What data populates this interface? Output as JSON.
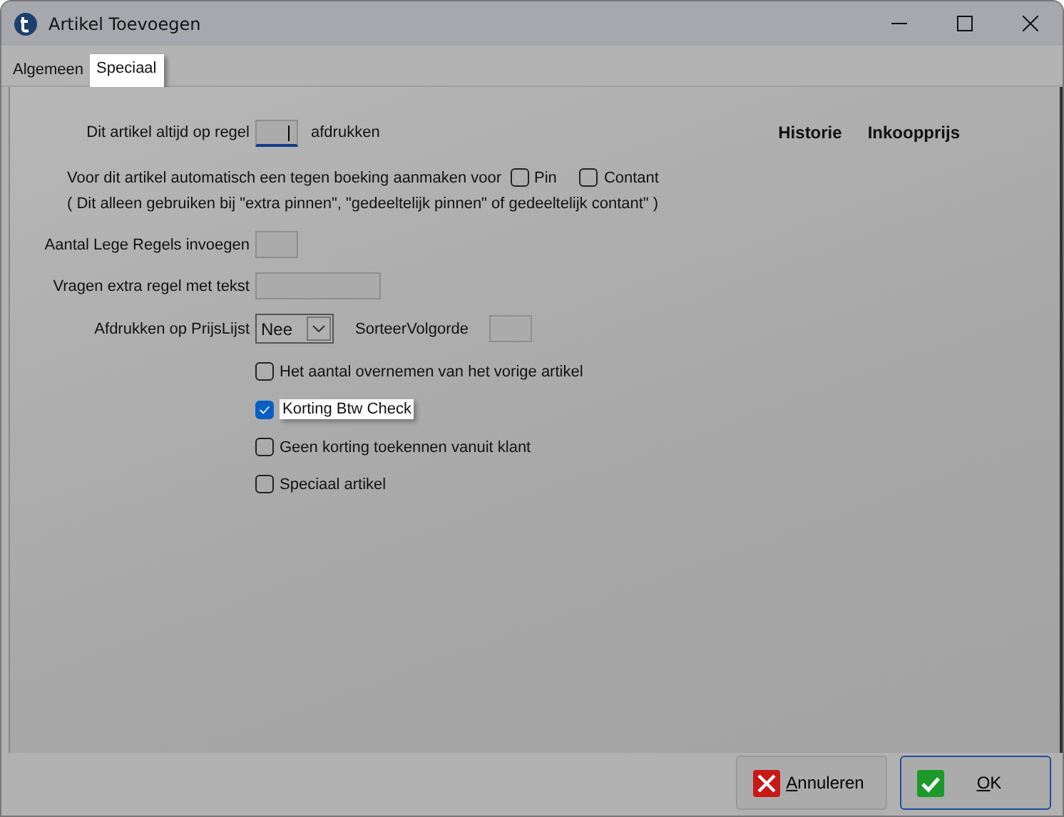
{
  "window": {
    "title": "Artikel Toevoegen"
  },
  "tabs": [
    {
      "label": "Algemeen",
      "selected": false
    },
    {
      "label": "Speciaal",
      "selected": true
    }
  ],
  "print_line": {
    "label": "Dit artikel altijd op regel",
    "suffix": "afdrukken"
  },
  "links": [
    "Historie",
    "Inkoopprijs"
  ],
  "auto_booking": {
    "label": "Voor dit artikel automatisch een tegen boeking aanmaken voor",
    "options": [
      {
        "label": "Pin",
        "checked": false
      },
      {
        "label": "Contant",
        "checked": false
      }
    ],
    "note": "( Dit alleen gebruiken bij \"extra pinnen\", \"gedeeltelijk pinnen\" of gedeeltelijk contant\" )"
  },
  "empty_lines": {
    "label": "Aantal Lege Regels invoegen"
  },
  "extra_line": {
    "label": "Vragen extra regel met tekst"
  },
  "price_list": {
    "label": "Afdrukken op PrijsLijst",
    "value": "Nee",
    "sort_label": "SorteerVolgorde"
  },
  "checkboxes": [
    {
      "label": "Het aantal overnemen van het vorige artikel",
      "checked": false,
      "selected": false
    },
    {
      "label": "Korting Btw Check",
      "checked": true,
      "selected": true
    },
    {
      "label": "Geen korting toekennen vanuit klant",
      "checked": false,
      "selected": false
    },
    {
      "label": "Speciaal artikel",
      "checked": false,
      "selected": false
    }
  ],
  "buttons": [
    {
      "label": "Annuleren",
      "kind": "cancel"
    },
    {
      "label": "OK",
      "kind": "ok"
    }
  ]
}
